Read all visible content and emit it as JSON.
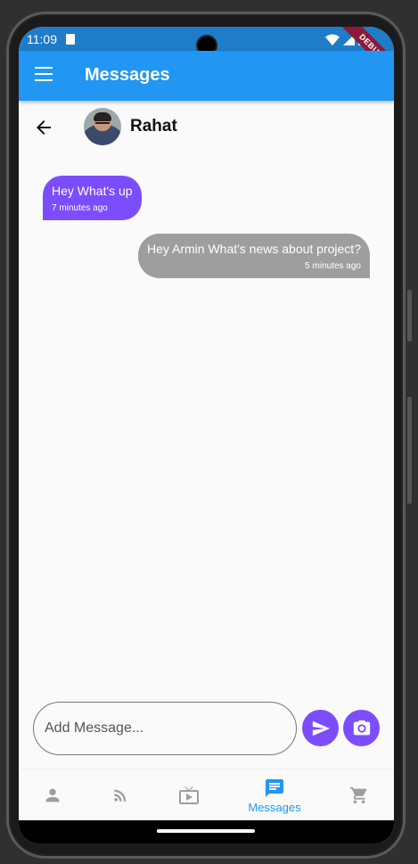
{
  "status": {
    "time": "11:09",
    "debug_label": "DEBUG"
  },
  "appbar": {
    "title": "Messages"
  },
  "chat": {
    "contact_name": "Rahat",
    "messages": [
      {
        "text": "Hey What's up",
        "time": "7 minutes ago",
        "direction": "incoming"
      },
      {
        "text": "Hey Armin What's news about project?",
        "time": "5 minutes ago",
        "direction": "outgoing"
      }
    ]
  },
  "composer": {
    "placeholder": "Add Message..."
  },
  "bottom_nav": {
    "items": [
      {
        "icon": "person-icon",
        "label": ""
      },
      {
        "icon": "rss-feed-icon",
        "label": ""
      },
      {
        "icon": "live-tv-icon",
        "label": ""
      },
      {
        "icon": "chat-icon",
        "label": "Messages",
        "active": true
      },
      {
        "icon": "shopping-cart-icon",
        "label": ""
      }
    ]
  },
  "colors": {
    "primary": "#2196f3",
    "accent": "#7c4dff",
    "outgoing_bubble": "#9e9e9e",
    "nav_inactive": "#9e9e9e"
  }
}
